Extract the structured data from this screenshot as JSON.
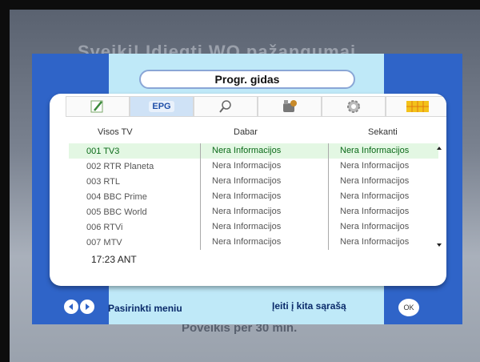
{
  "background": {
    "banner_text": "Sveiki! Įdiegti WO pažangumai",
    "footer_text": "Poveikis per 30 min."
  },
  "title": "Progr. gidas",
  "tabs": [
    {
      "icon": "edit-icon",
      "label": ""
    },
    {
      "icon": "epg-icon",
      "label": "EPG"
    },
    {
      "icon": "search-icon",
      "label": ""
    },
    {
      "icon": "tools-icon",
      "label": ""
    },
    {
      "icon": "gear-icon",
      "label": ""
    },
    {
      "icon": "grid-icon",
      "label": ""
    }
  ],
  "columns": [
    "Visos TV",
    "Dabar",
    "Sekanti"
  ],
  "channels": [
    {
      "name": "001  TV3",
      "now": "Nera Informacijos",
      "next": "Nera Informacijos"
    },
    {
      "name": "002  RTR Planeta",
      "now": "Nera Informacijos",
      "next": "Nera Informacijos"
    },
    {
      "name": "003  RTL",
      "now": "Nera Informacijos",
      "next": "Nera Informacijos"
    },
    {
      "name": "004  BBC Prime",
      "now": "Nera Informacijos",
      "next": "Nera Informacijos"
    },
    {
      "name": "005  BBC World",
      "now": "Nera Informacijos",
      "next": "Nera Informacijos"
    },
    {
      "name": "006  RTVi",
      "now": "Nera Informacijos",
      "next": "Nera Informacijos"
    },
    {
      "name": "007  MTV",
      "now": "Nera Informacijos",
      "next": "Nera Informacijos"
    }
  ],
  "clock": "17:23 ANT",
  "footer": {
    "left_hint": "Pasirinkti meniu",
    "right_hint": "Įeiti į kita sąrašą",
    "ok_label": "OK"
  },
  "colors": {
    "panel_blue": "#2f64c8",
    "inner_cyan": "#bfe9f8",
    "selected_green": "#0b6a19"
  }
}
